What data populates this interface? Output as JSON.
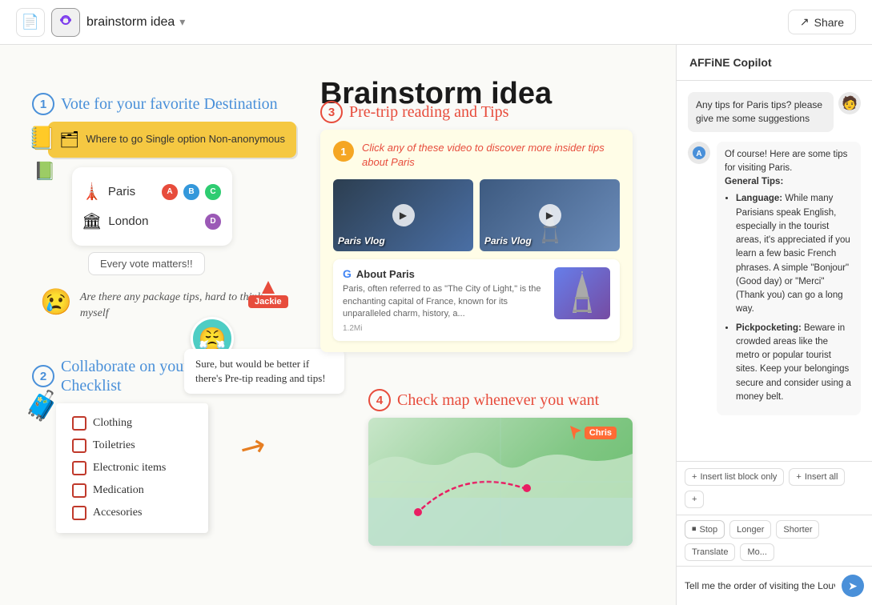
{
  "topbar": {
    "title": "brainstorm idea",
    "share_label": "Share"
  },
  "page": {
    "title": "Brainstorm idea"
  },
  "section1": {
    "number": "1",
    "title": "Vote for your favorite Destination",
    "vote_card_icon": "🗂",
    "vote_card_text": "Where to go Single option Non-anonymous",
    "paris_label": "Paris",
    "london_label": "London",
    "every_vote": "Every vote matters!!",
    "feedback_emoji": "😢",
    "feedback_text": "Are there any package tips, hard to think myself"
  },
  "section2": {
    "number": "2",
    "title": "Collaborate on your Packing Checklist",
    "items": [
      "Clothing",
      "Toiletries",
      "Electronic items",
      "Medication",
      "Accesories"
    ],
    "comment": "Sure, but would be better if there's Pre-tip reading and tips!",
    "angry_emoji": "😤"
  },
  "section3": {
    "number": "3",
    "title": "Pre-trip reading and Tips",
    "step1_text": "Click any of these video to discover more insider tips about Paris",
    "video1_label": "Paris Vlog",
    "video2_label": "Paris Vlog",
    "about_title": "About Paris",
    "about_desc": "Paris, often referred to as \"The City of Light,\" is the enchanting capital of France, known for its unparalleled charm, history, a...",
    "about_source": "1.2Mi"
  },
  "section4": {
    "number": "4",
    "title": "Check map whenever you want"
  },
  "copilot": {
    "header": "AFFiNE Copilot",
    "user_message": "Any tips for Paris tips? please give me some suggestions",
    "ai_intro": "Of course! Here are some tips for visiting Paris.",
    "ai_general": "General Tips:",
    "ai_tip1_title": "Language:",
    "ai_tip1_text": "While many Parisians speak English, especially in the tourist areas, it's appreciated if you learn a few basic French phrases. A simple \"Bonjour\" (Good day) or \"Merci\" (Thank you) can go a long way.",
    "ai_tip2_title": "Pickpocketing:",
    "ai_tip2_text": "Beware in crowded areas like the metro or popular tourist sites. Keep your belongings secure and consider using a money belt.",
    "btn_insert_block": "Insert list block only",
    "btn_insert_all": "Insert all",
    "btn_stop": "Stop",
    "btn_longer": "Longer",
    "btn_shorter": "Shorter",
    "btn_translate": "Translate",
    "btn_more": "Mo...",
    "input_placeholder": "Tell me the order of visiting the Louvre",
    "jackie_label": "Jackie",
    "chris_label": "Chris"
  }
}
